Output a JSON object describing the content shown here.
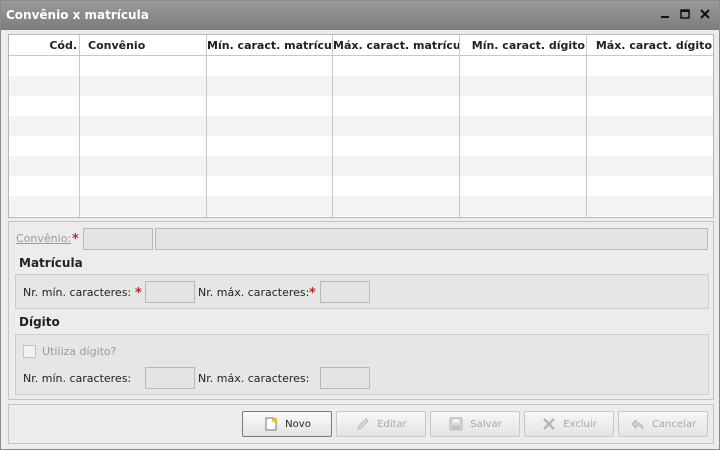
{
  "window": {
    "title": "Convênio x matrícula"
  },
  "grid": {
    "columns": [
      "Cód.",
      "Convênio",
      "Mín. caract. matrícula",
      "Máx. caract. matrícula",
      "Mín. caract. dígito",
      "Máx. caract. dígito"
    ],
    "rows": []
  },
  "form": {
    "convenio_label": "Convênio:",
    "convenio_code_value": "",
    "convenio_name_value": "",
    "matricula": {
      "title": "Matrícula",
      "min_label": "Nr. mín. caracteres:",
      "max_label": "Nr. máx. caracteres:",
      "min_value": "",
      "max_value": ""
    },
    "digito": {
      "title": "Dígito",
      "checkbox_label": "Utiliza dígito?",
      "min_label": "Nr. mín. caracteres:",
      "max_label": "Nr. máx. caracteres:",
      "min_value": "",
      "max_value": ""
    },
    "required_mark": "*"
  },
  "buttons": {
    "novo": "Novo",
    "editar": "Editar",
    "salvar": "Salvar",
    "excluir": "Excluir",
    "cancelar": "Cancelar"
  },
  "colors": {
    "required": "#c0282b",
    "titlebar": "#8a8a8a"
  }
}
